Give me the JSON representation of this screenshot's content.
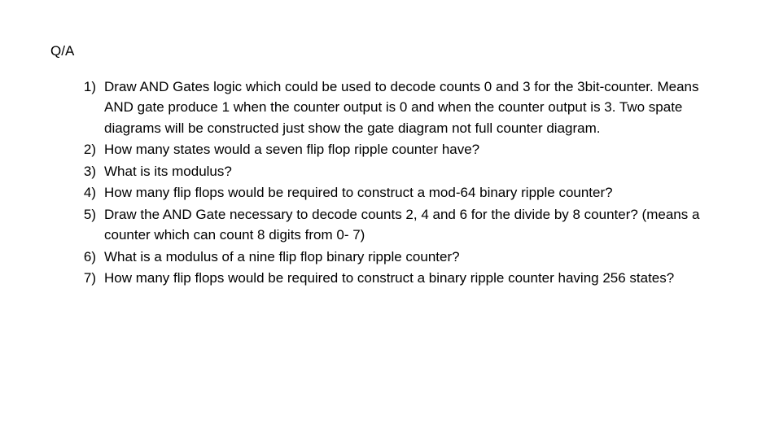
{
  "heading": "Q/A",
  "questions": [
    {
      "number": "1)",
      "text": "Draw AND Gates logic which could be used to decode counts 0 and 3 for the 3bit-counter. Means AND gate produce 1 when the counter output is 0 and when the counter output is 3. Two spate diagrams will be constructed just show the gate diagram not full counter diagram."
    },
    {
      "number": "2)",
      "text": "How many states would a seven flip flop ripple counter have?"
    },
    {
      "number": "3)",
      "text": "What is its modulus?"
    },
    {
      "number": "4)",
      "text": "How many flip flops would be required to construct a mod-64 binary ripple counter?"
    },
    {
      "number": "5)",
      "text": "Draw the AND Gate necessary to decode counts 2, 4 and 6 for the divide by 8 counter? (means a counter which can count 8 digits from 0- 7)"
    },
    {
      "number": "6)",
      "text": "What is a modulus of a nine flip flop binary ripple counter?"
    },
    {
      "number": "7)",
      "text": "How many flip flops would be required to construct a binary ripple counter having 256 states?"
    }
  ]
}
